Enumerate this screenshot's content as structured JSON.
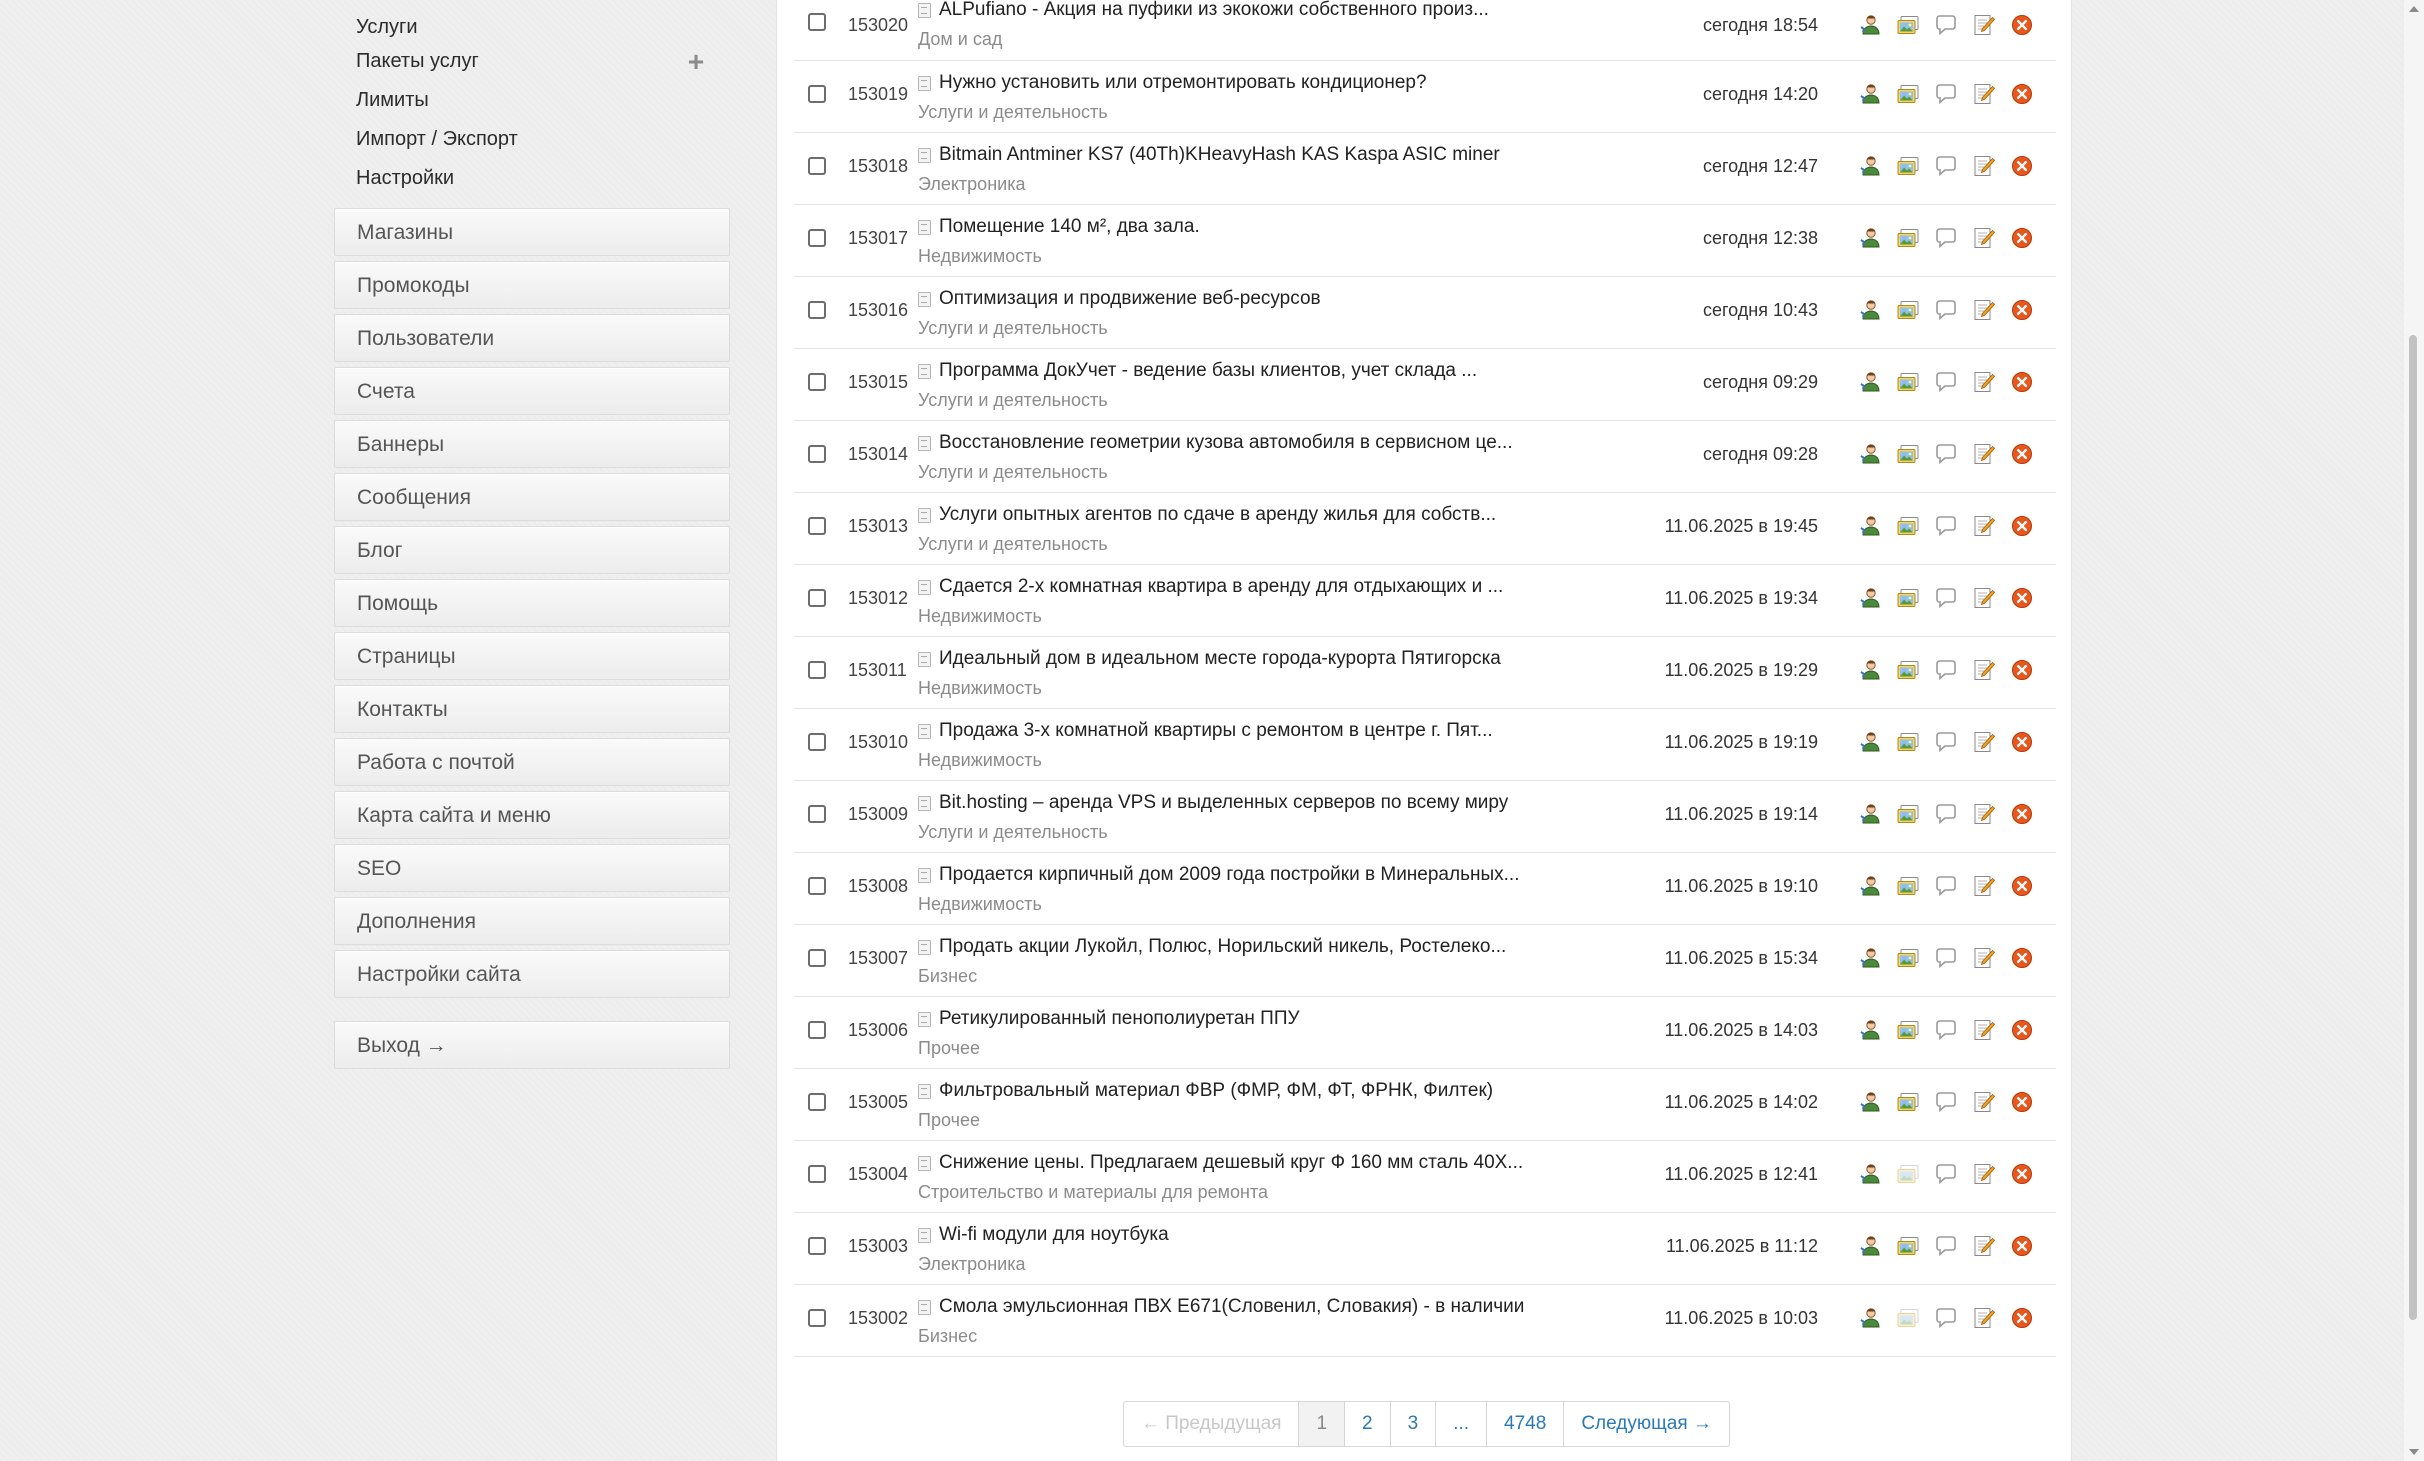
{
  "sidebar": {
    "sub_items": [
      {
        "label": "Услуги",
        "has_add": false
      },
      {
        "label": "Пакеты услуг",
        "has_add": true
      },
      {
        "label": "Лимиты",
        "has_add": false
      },
      {
        "label": "Импорт / Экспорт",
        "has_add": false
      },
      {
        "label": "Настройки",
        "has_add": false
      }
    ],
    "menu": [
      {
        "label": "Магазины"
      },
      {
        "label": "Промокоды"
      },
      {
        "label": "Пользователи"
      },
      {
        "label": "Счета"
      },
      {
        "label": "Баннеры"
      },
      {
        "label": "Сообщения"
      },
      {
        "label": "Блог"
      },
      {
        "label": "Помощь"
      },
      {
        "label": "Страницы"
      },
      {
        "label": "Контакты"
      },
      {
        "label": "Работа с почтой"
      },
      {
        "label": "Карта сайта и меню"
      },
      {
        "label": "SEO"
      },
      {
        "label": "Дополнения"
      },
      {
        "label": "Настройки сайта"
      }
    ],
    "logout_label": "Выход →",
    "plus_glyph": "+"
  },
  "listings": [
    {
      "id": "153020",
      "title": "ALPufiano - Акция на пуфики из экокожи собственного произ...",
      "category": "Дом и сад",
      "date": "сегодня 18:54",
      "images_active": true
    },
    {
      "id": "153019",
      "title": "Нужно установить или отремонтировать кондиционер?",
      "category": "Услуги и деятельность",
      "date": "сегодня 14:20",
      "images_active": true
    },
    {
      "id": "153018",
      "title": "Bitmain Antminer KS7 (40Th)KHeavyHash KAS Kaspa ASIC miner",
      "category": "Электроника",
      "date": "сегодня 12:47",
      "images_active": true
    },
    {
      "id": "153017",
      "title": "Помещение 140 м², два зала.",
      "category": "Недвижимость",
      "date": "сегодня 12:38",
      "images_active": true
    },
    {
      "id": "153016",
      "title": "Оптимизация и продвижение веб-ресурсов",
      "category": "Услуги и деятельность",
      "date": "сегодня 10:43",
      "images_active": true
    },
    {
      "id": "153015",
      "title": "Программа ДокУчет - ведение базы клиентов, учет склада ...",
      "category": "Услуги и деятельность",
      "date": "сегодня 09:29",
      "images_active": true
    },
    {
      "id": "153014",
      "title": "Восстановление геометрии кузова автомобиля в сервисном це...",
      "category": "Услуги и деятельность",
      "date": "сегодня 09:28",
      "images_active": true
    },
    {
      "id": "153013",
      "title": "Услуги опытных агентов по сдаче в аренду жилья для собств...",
      "category": "Услуги и деятельность",
      "date": "11.06.2025 в 19:45",
      "images_active": true
    },
    {
      "id": "153012",
      "title": "Сдается 2-х комнатная квартира в аренду для отдыхающих и ...",
      "category": "Недвижимость",
      "date": "11.06.2025 в 19:34",
      "images_active": true
    },
    {
      "id": "153011",
      "title": "Идеальный дом в идеальном месте города-курорта Пятигорска",
      "category": "Недвижимость",
      "date": "11.06.2025 в 19:29",
      "images_active": true
    },
    {
      "id": "153010",
      "title": "Продажа 3-х комнатной квартиры с ремонтом в центре г. Пят...",
      "category": "Недвижимость",
      "date": "11.06.2025 в 19:19",
      "images_active": true
    },
    {
      "id": "153009",
      "title": "Bit.hosting – аренда VPS и выделенных серверов по всему миру",
      "category": "Услуги и деятельность",
      "date": "11.06.2025 в 19:14",
      "images_active": true
    },
    {
      "id": "153008",
      "title": "Продается кирпичный дом 2009 года постройки в Минеральных...",
      "category": "Недвижимость",
      "date": "11.06.2025 в 19:10",
      "images_active": true
    },
    {
      "id": "153007",
      "title": "Продать акции Лукойл, Полюс, Норильский никель, Ростелеко...",
      "category": "Бизнес",
      "date": "11.06.2025 в 15:34",
      "images_active": true
    },
    {
      "id": "153006",
      "title": "Ретикулированный пенополиуретан ППУ",
      "category": "Прочее",
      "date": "11.06.2025 в 14:03",
      "images_active": true
    },
    {
      "id": "153005",
      "title": "Фильтровальный материал ФВР (ФМР, ФМ, ФТ, ФРНК, Филтек)",
      "category": "Прочее",
      "date": "11.06.2025 в 14:02",
      "images_active": true
    },
    {
      "id": "153004",
      "title": "Снижение цены. Предлагаем дешевый круг Ф 160 мм сталь 40Х...",
      "category": "Строительство и материалы для ремонта",
      "date": "11.06.2025 в 12:41",
      "images_active": false
    },
    {
      "id": "153003",
      "title": "Wi-fi модули для ноутбука",
      "category": "Электроника",
      "date": "11.06.2025 в 11:12",
      "images_active": true
    },
    {
      "id": "153002",
      "title": "Смола эмульсионная ПВХ Е671(Словенил, Словакия) - в наличии",
      "category": "Бизнес",
      "date": "11.06.2025 в 10:03",
      "images_active": false
    }
  ],
  "pagination": {
    "prev_label": "← Предыдущая",
    "pages": [
      "1",
      "2",
      "3",
      "...",
      "4748"
    ],
    "current_page": "1",
    "next_label": "Следующая →"
  },
  "icons": {
    "user": "user-icon",
    "images": "images-icon",
    "comment": "comment-icon",
    "edit": "edit-icon",
    "delete": "delete-icon"
  },
  "colors": {
    "link": "#2a7ab8",
    "delete": "#e8571e",
    "user_green": "#4a8a3a",
    "edit_orange": "#f0a020"
  }
}
